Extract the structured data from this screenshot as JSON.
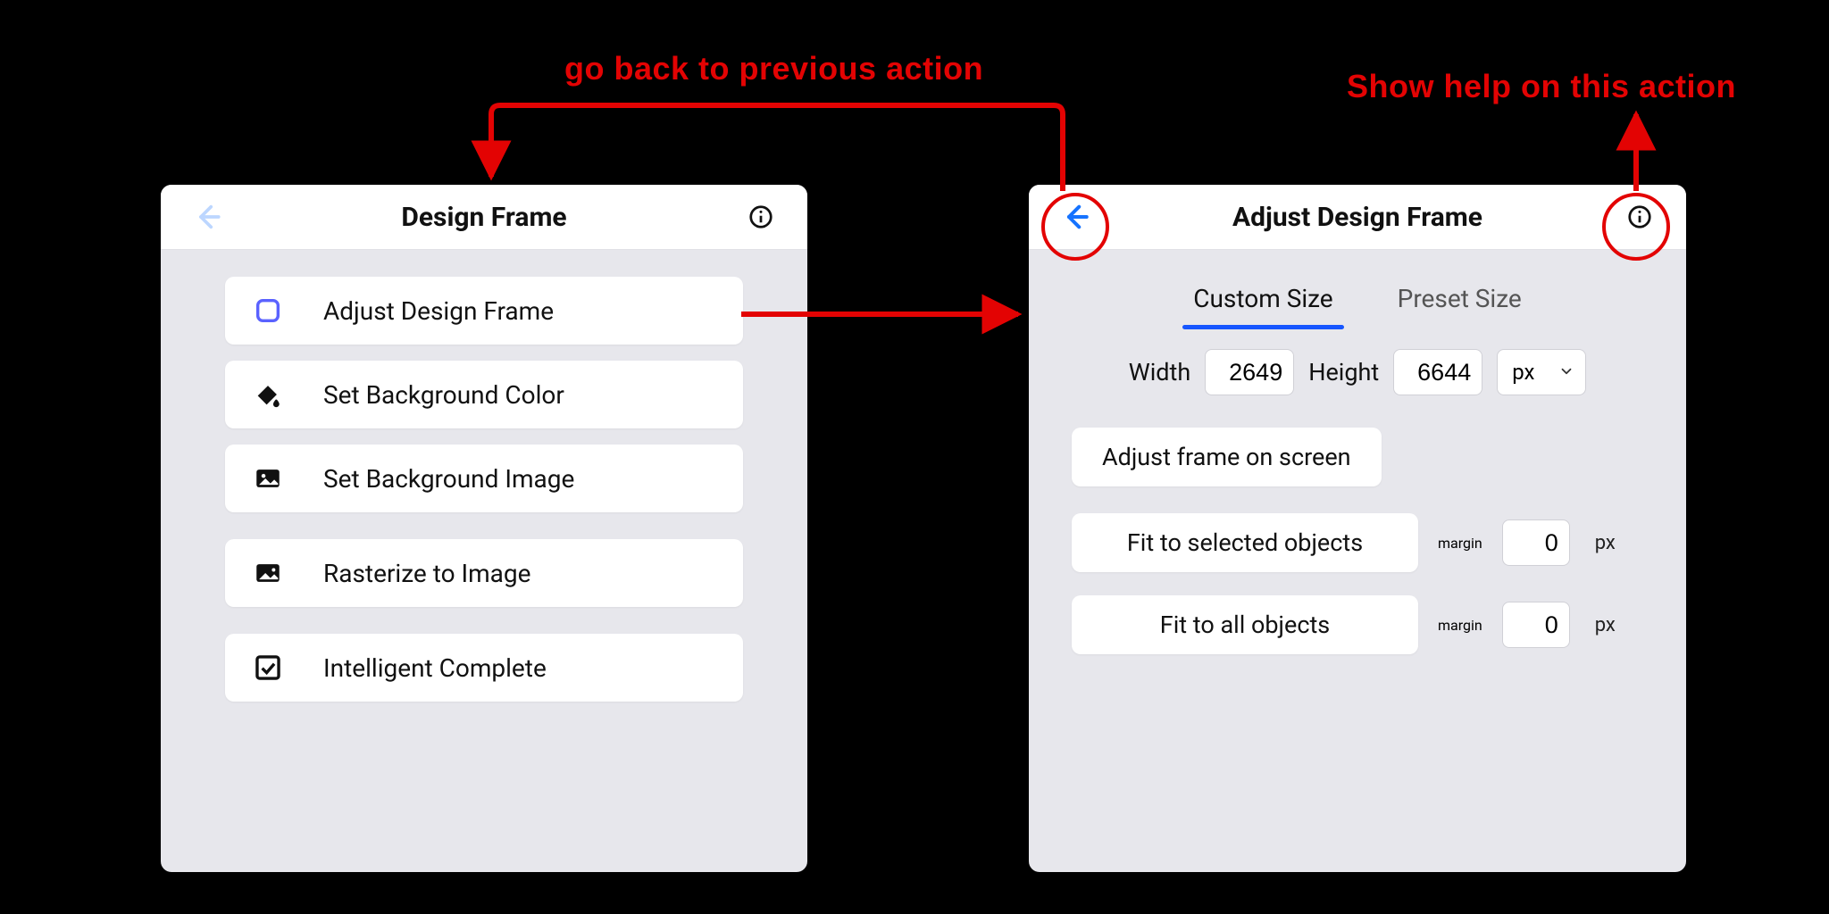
{
  "annotations": {
    "back_caption": "go back to previous action",
    "help_caption": "Show help on this action"
  },
  "colors": {
    "annotation_red": "#e30303",
    "tab_underline_blue": "#1656ff",
    "back_arrow_blue": "#1673ff",
    "back_arrow_disabled": "#bcd6ff"
  },
  "left_panel": {
    "title": "Design Frame",
    "items": [
      {
        "icon": "square-outline-icon",
        "label": "Adjust Design Frame"
      },
      {
        "icon": "paint-bucket-icon",
        "label": "Set Background Color"
      },
      {
        "icon": "image-icon",
        "label": "Set Background Image"
      },
      {
        "icon": "image-rasterize-icon",
        "label": "Rasterize to Image"
      },
      {
        "icon": "checkbox-icon",
        "label": "Intelligent Complete"
      }
    ]
  },
  "right_panel": {
    "title": "Adjust Design Frame",
    "tabs": {
      "custom": "Custom Size",
      "preset": "Preset Size",
      "active": "custom"
    },
    "size": {
      "width_label": "Width",
      "width_value": "2649",
      "height_label": "Height",
      "height_value": "6644",
      "unit": "px"
    },
    "buttons": {
      "adjust_on_screen": "Adjust frame on screen",
      "fit_selected": "Fit to selected objects",
      "fit_all": "Fit to all objects"
    },
    "margins": {
      "label": "margin",
      "selected_value": "0",
      "all_value": "0",
      "unit": "px"
    }
  }
}
